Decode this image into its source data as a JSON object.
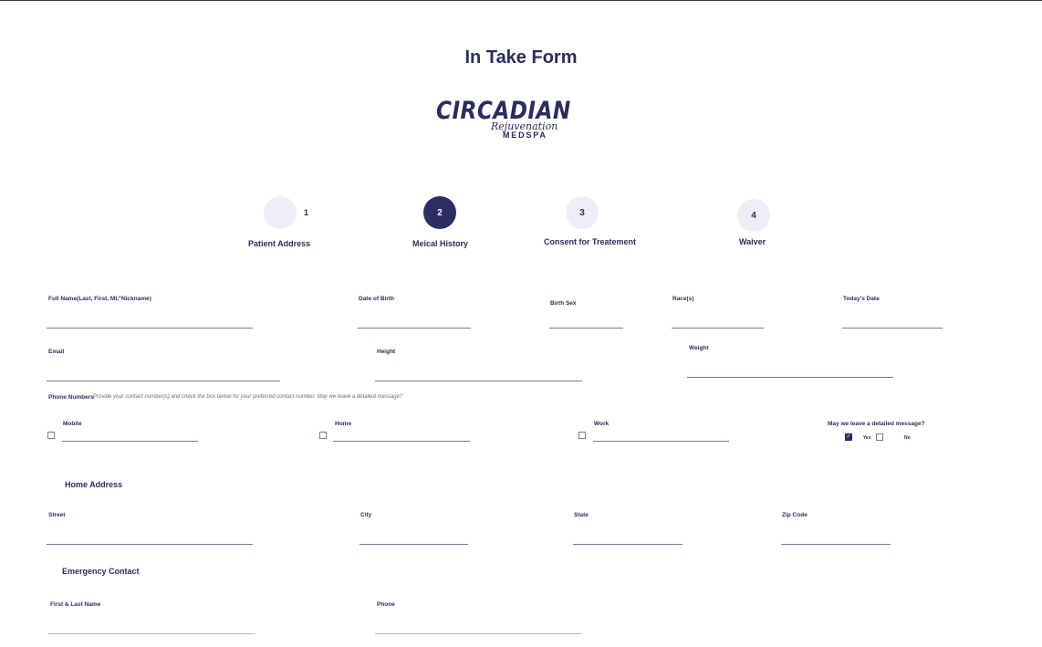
{
  "page": {
    "title": "In Take Form"
  },
  "logo": {
    "brand": "CIRCADIAN",
    "script": "Rejuvenation",
    "sub": "MEDSPA"
  },
  "steps": [
    {
      "number": "1",
      "label": "Patient Address",
      "active": false
    },
    {
      "number": "2",
      "label": "Meical History",
      "active": true
    },
    {
      "number": "3",
      "label": "Consent for Treatement",
      "active": false
    },
    {
      "number": "4",
      "label": "Waiver",
      "active": false
    }
  ],
  "fields": {
    "full_name": "Full Name(Last, First, MI,\"Nickname)",
    "dob": "Date of Birth",
    "birth_sex": "Birth Sex",
    "race": "Race(s)",
    "today": "Today's Date",
    "email": "Email",
    "height": "Height",
    "weight": "Weight"
  },
  "phone": {
    "label": "Phone Numbers",
    "hint": "Provide your contact number(s) and check the box below for your preferred contact number. May we leave a detailed message?",
    "mobile": "Mobile",
    "home": "Home",
    "work": "Work",
    "message_question": "May we leave a detailed message?",
    "yes": "Yes",
    "no": "No",
    "yes_checked": true,
    "no_checked": false
  },
  "home_address": {
    "heading": "Home Address",
    "street": "Street",
    "city": "City",
    "state": "State",
    "zip": "Zip Code"
  },
  "emergency": {
    "heading": "Emergency Contact",
    "name": "First & Last Name",
    "phone": "Phone"
  },
  "colors": {
    "primary": "#2e2d63",
    "step_inactive": "#eeeef8",
    "line": "#7a7b95"
  }
}
